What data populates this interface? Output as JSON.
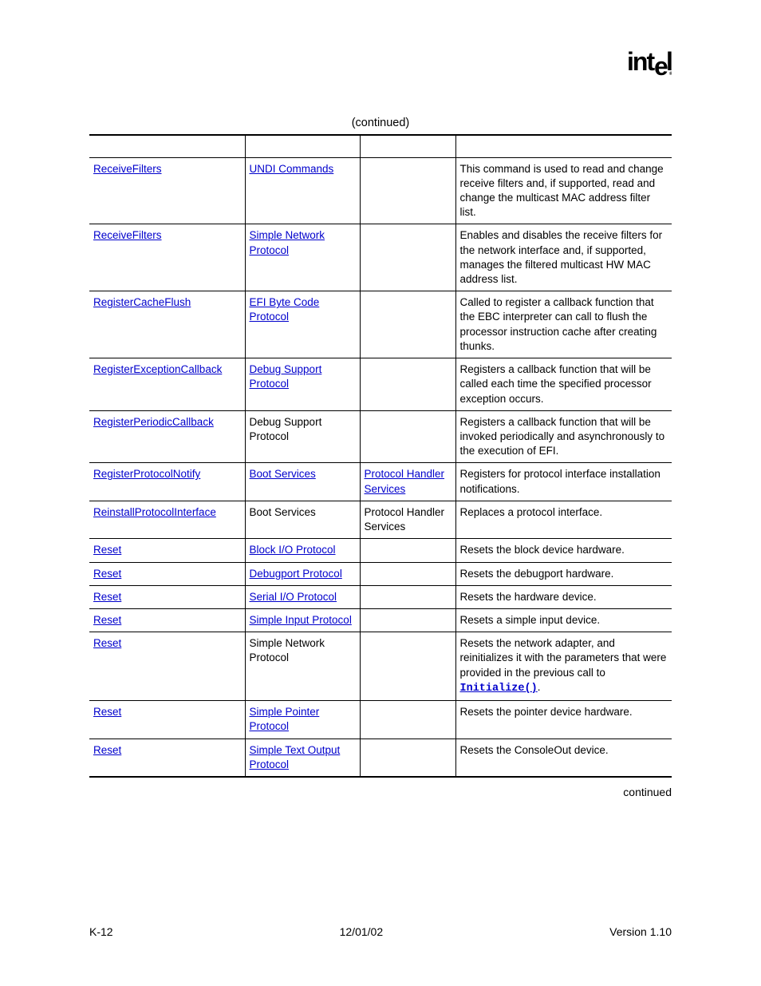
{
  "logo_text": "intel",
  "continued_top": "(continued)",
  "continued_bottom": "continued",
  "rows": [
    {
      "c1": {
        "text": "ReceiveFilters",
        "link": true
      },
      "c2": {
        "text": "UNDI Commands",
        "link": true
      },
      "c3": {
        "text": "",
        "link": false
      },
      "c4": {
        "parts": [
          {
            "t": "This command is used to read and change receive filters and, if supported, read and change the multicast MAC address filter list."
          }
        ]
      }
    },
    {
      "c1": {
        "text": "ReceiveFilters",
        "link": true
      },
      "c2": {
        "text": "Simple Network Protocol",
        "link": true
      },
      "c3": {
        "text": "",
        "link": false
      },
      "c4": {
        "parts": [
          {
            "t": "Enables and disables the receive filters for the network interface and, if supported, manages the filtered multicast HW MAC address list."
          }
        ]
      }
    },
    {
      "c1": {
        "text": "RegisterCacheFlush",
        "link": true
      },
      "c2": {
        "text": "EFI Byte Code Protocol",
        "link": true
      },
      "c3": {
        "text": "",
        "link": false
      },
      "c4": {
        "parts": [
          {
            "t": "Called to register a callback function that the EBC interpreter can call to flush the processor instruction cache after creating thunks."
          }
        ]
      }
    },
    {
      "c1": {
        "text": "RegisterExceptionCallback",
        "link": true
      },
      "c2": {
        "text": "Debug Support Protocol",
        "link": true
      },
      "c3": {
        "text": "",
        "link": false
      },
      "c4": {
        "parts": [
          {
            "t": "Registers a callback function that will be called each time the specified processor exception occurs."
          }
        ]
      }
    },
    {
      "c1": {
        "text": "RegisterPeriodicCallback",
        "link": true
      },
      "c2": {
        "text": "Debug Support Protocol",
        "link": false
      },
      "c3": {
        "text": "",
        "link": false
      },
      "c4": {
        "parts": [
          {
            "t": "Registers a callback function that will be invoked periodically and asynchronously to the execution of EFI."
          }
        ]
      }
    },
    {
      "c1": {
        "text": "RegisterProtocolNotify",
        "link": true
      },
      "c2": {
        "text": "Boot Services",
        "link": true
      },
      "c3": {
        "text": "Protocol Handler Services",
        "link": true
      },
      "c4": {
        "parts": [
          {
            "t": "Registers for protocol interface installation notifications."
          }
        ]
      }
    },
    {
      "c1": {
        "text": "ReinstallProtocolInterface",
        "link": true
      },
      "c2": {
        "text": "Boot Services",
        "link": false
      },
      "c3": {
        "text": "Protocol Handler Services",
        "link": false
      },
      "c4": {
        "parts": [
          {
            "t": "Replaces a protocol interface."
          }
        ]
      }
    },
    {
      "c1": {
        "text": "Reset",
        "link": true
      },
      "c2": {
        "text": "Block I/O Protocol",
        "link": true
      },
      "c3": {
        "text": "",
        "link": false
      },
      "c4": {
        "parts": [
          {
            "t": "Resets the block device hardware."
          }
        ]
      }
    },
    {
      "c1": {
        "text": "Reset",
        "link": true
      },
      "c2": {
        "text": "Debugport Protocol",
        "link": true
      },
      "c3": {
        "text": "",
        "link": false
      },
      "c4": {
        "parts": [
          {
            "t": "Resets the debugport hardware."
          }
        ]
      }
    },
    {
      "c1": {
        "text": "Reset",
        "link": true
      },
      "c2": {
        "text": "Serial I/O Protocol",
        "link": true
      },
      "c3": {
        "text": "",
        "link": false
      },
      "c4": {
        "parts": [
          {
            "t": "Resets the hardware device."
          }
        ]
      }
    },
    {
      "c1": {
        "text": "Reset",
        "link": true
      },
      "c2": {
        "text": "Simple Input Protocol",
        "link": true
      },
      "c3": {
        "text": "",
        "link": false
      },
      "c4": {
        "parts": [
          {
            "t": "Resets a simple input device."
          }
        ]
      }
    },
    {
      "c1": {
        "text": "Reset",
        "link": true
      },
      "c2": {
        "text": "Simple Network Protocol",
        "link": false
      },
      "c3": {
        "text": "",
        "link": false
      },
      "c4": {
        "parts": [
          {
            "t": "Resets the network adapter, and reinitializes it with the parameters that were provided in the previous call to "
          },
          {
            "t": "Initialize()",
            "mono": true,
            "link": true
          },
          {
            "t": "."
          }
        ]
      }
    },
    {
      "c1": {
        "text": "Reset",
        "link": true
      },
      "c2": {
        "text": "Simple Pointer Protocol",
        "link": true
      },
      "c3": {
        "text": "",
        "link": false
      },
      "c4": {
        "parts": [
          {
            "t": "Resets the pointer device hardware."
          }
        ]
      }
    },
    {
      "c1": {
        "text": "Reset",
        "link": true
      },
      "c2": {
        "text": "Simple Text Output Protocol",
        "link": true
      },
      "c3": {
        "text": "",
        "link": false
      },
      "c4": {
        "parts": [
          {
            "t": "Resets the ConsoleOut device."
          }
        ]
      }
    }
  ],
  "footer": {
    "left": "K-12",
    "center": "12/01/02",
    "right": "Version 1.10"
  }
}
